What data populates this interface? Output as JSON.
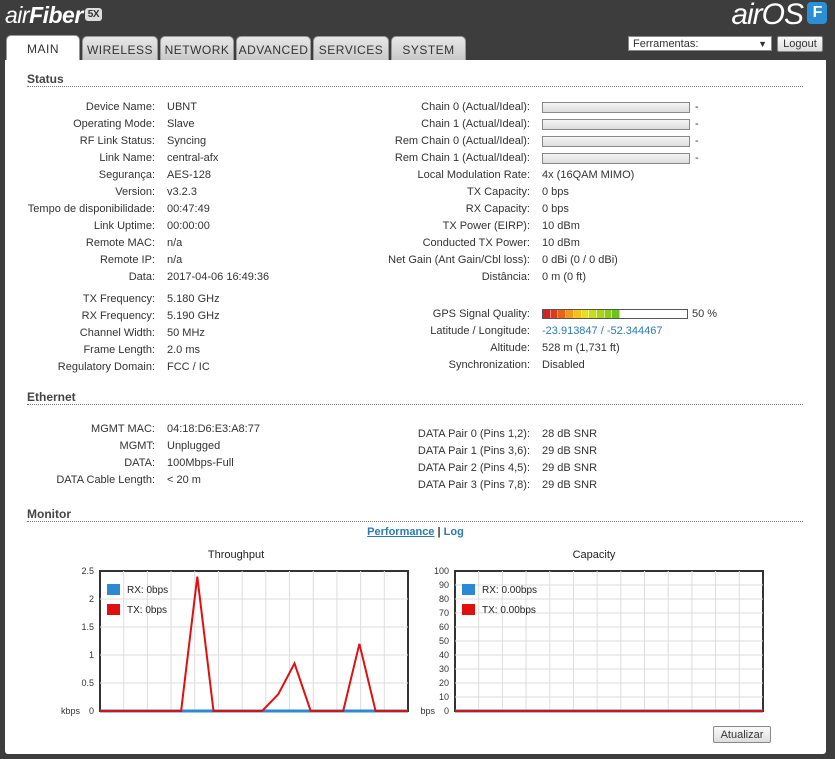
{
  "brand": {
    "left_air": "air",
    "left_fiber": "Fiber",
    "left_badge": "5X",
    "right_name": "airOS",
    "right_badge": "F"
  },
  "tabs": [
    {
      "label": "MAIN",
      "active": true
    },
    {
      "label": "WIRELESS",
      "active": false
    },
    {
      "label": "NETWORK",
      "active": false
    },
    {
      "label": "ADVANCED",
      "active": false
    },
    {
      "label": "SERVICES",
      "active": false
    },
    {
      "label": "SYSTEM",
      "active": false
    }
  ],
  "toolbar": {
    "tools_selected": "Ferramentas:",
    "logout_label": "Logout"
  },
  "status": {
    "title": "Status",
    "left": [
      {
        "label": "Device Name:",
        "value": "UBNT"
      },
      {
        "label": "Operating Mode:",
        "value": "Slave"
      },
      {
        "label": "RF Link Status:",
        "value": "Syncing"
      },
      {
        "label": "Link Name:",
        "value": "central-afx"
      },
      {
        "label": "Segurança:",
        "value": "AES-128"
      },
      {
        "label": "Version:",
        "value": "v3.2.3"
      },
      {
        "label": "Tempo de disponibilidade:",
        "value": "00:47:49"
      },
      {
        "label": "Link Uptime:",
        "value": "00:00:00"
      },
      {
        "label": "Remote MAC:",
        "value": "n/a"
      },
      {
        "label": "Remote IP:",
        "value": "n/a"
      },
      {
        "label": "Data:",
        "value": "2017-04-06 16:49:36"
      }
    ],
    "left2": [
      {
        "label": "TX Frequency:",
        "value": "5.180 GHz"
      },
      {
        "label": "RX Frequency:",
        "value": "5.190 GHz"
      },
      {
        "label": "Channel Width:",
        "value": "50 MHz"
      },
      {
        "label": "Frame Length:",
        "value": "2.0 ms"
      },
      {
        "label": "Regulatory Domain:",
        "value": "FCC / IC"
      }
    ],
    "chains": [
      {
        "label": "Chain 0 (Actual/Ideal):",
        "value": "-"
      },
      {
        "label": "Chain 1 (Actual/Ideal):",
        "value": "-"
      },
      {
        "label": "Rem Chain 0 (Actual/Ideal):",
        "value": "-"
      },
      {
        "label": "Rem Chain 1 (Actual/Ideal):",
        "value": "-"
      }
    ],
    "right": [
      {
        "label": "Local Modulation Rate:",
        "value": "4x (16QAM MIMO)"
      },
      {
        "label": "TX Capacity:",
        "value": "0 bps"
      },
      {
        "label": "RX Capacity:",
        "value": "0 bps"
      },
      {
        "label": "TX Power (EIRP):",
        "value": "10 dBm"
      },
      {
        "label": "Conducted TX Power:",
        "value": "10 dBm"
      },
      {
        "label": "Net Gain (Ant Gain/Cbl loss):",
        "value": "0 dBi (0 / 0 dBi)"
      },
      {
        "label": "Distância:",
        "value": "0 m (0 ft)"
      }
    ],
    "gps": {
      "quality_label": "GPS Signal Quality:",
      "quality_value": "50 %",
      "quality_fraction": 0.5,
      "latlon_label": "Latitude / Longitude:",
      "latlon_value": "-23.913847 / -52.344467",
      "altitude_label": "Altitude:",
      "altitude_value": "528 m (1,731 ft)",
      "sync_label": "Synchronization:",
      "sync_value": "Disabled"
    }
  },
  "ethernet": {
    "title": "Ethernet",
    "left": [
      {
        "label": "MGMT MAC:",
        "value": "04:18:D6:E3:A8:77"
      },
      {
        "label": "MGMT:",
        "value": "Unplugged"
      },
      {
        "label": "DATA:",
        "value": "100Mbps-Full"
      },
      {
        "label": "DATA Cable Length:",
        "value": "< 20 m"
      }
    ],
    "right": [
      {
        "label": "DATA Pair 0 (Pins 1,2):",
        "value": "28 dB SNR"
      },
      {
        "label": "DATA Pair 1 (Pins 3,6):",
        "value": "29 dB SNR"
      },
      {
        "label": "DATA Pair 2 (Pins 4,5):",
        "value": "29 dB SNR"
      },
      {
        "label": "DATA Pair 3 (Pins 7,8):",
        "value": "29 dB SNR"
      }
    ]
  },
  "monitor": {
    "title": "Monitor",
    "performance_link": "Performance",
    "separator": " | ",
    "log_link": "Log",
    "refresh_label": "Atualizar"
  },
  "chart_data": [
    {
      "type": "line",
      "title": "Throughput",
      "unit_label": "kbps",
      "ylim": [
        0,
        2.5
      ],
      "yticks": [
        "0",
        "0.5",
        "1",
        "1.5",
        "2",
        "2.5"
      ],
      "grid": true,
      "legend_position": "top-left",
      "colors": {
        "rx": "#2b8ad3",
        "tx": "#e01010"
      },
      "series": [
        {
          "name": "RX: 0bps",
          "values": [
            0,
            0,
            0,
            0,
            0,
            0,
            0,
            0,
            0,
            0,
            0,
            0,
            0,
            0,
            0,
            0,
            0,
            0,
            0,
            0
          ]
        },
        {
          "name": "TX: 0bps",
          "values": [
            0,
            0,
            0,
            0,
            0,
            0,
            2.4,
            0,
            0,
            0,
            0,
            0.3,
            0.85,
            0,
            0,
            0,
            1.2,
            0,
            0,
            0
          ]
        }
      ]
    },
    {
      "type": "line",
      "title": "Capacity",
      "unit_label": "bps",
      "ylim": [
        0,
        100
      ],
      "yticks": [
        "0",
        "10",
        "20",
        "30",
        "40",
        "50",
        "60",
        "70",
        "80",
        "90",
        "100"
      ],
      "grid": true,
      "legend_position": "top-left",
      "colors": {
        "rx": "#2b8ad3",
        "tx": "#e01010"
      },
      "series": [
        {
          "name": "RX: 0.00bps",
          "values": [
            0,
            0,
            0,
            0,
            0,
            0,
            0,
            0,
            0,
            0,
            0,
            0,
            0,
            0,
            0,
            0,
            0,
            0,
            0,
            0
          ]
        },
        {
          "name": "TX: 0.00bps",
          "values": [
            0,
            0,
            0,
            0,
            0,
            0,
            0,
            0,
            0,
            0,
            0,
            0,
            0,
            0,
            0,
            0,
            0,
            0,
            0,
            0
          ]
        }
      ]
    }
  ]
}
